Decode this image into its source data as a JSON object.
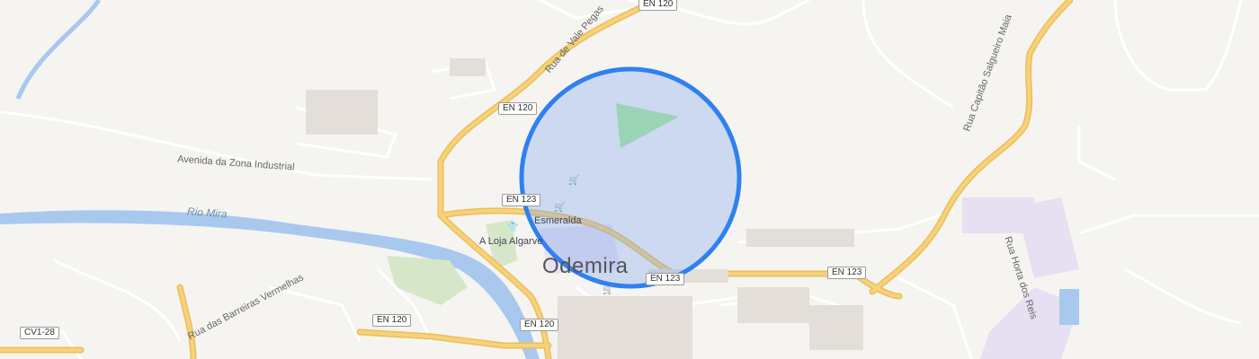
{
  "map": {
    "town": "Odemira",
    "river": "Rio Mira",
    "streets": {
      "avenida_zona_industrial": "Avenida da Zona Industrial",
      "rua_vale_pegas": "Rua de Vale Pegas",
      "rua_barreiras": "Rua das Barreiras Vermelhas",
      "rua_capitao": "Rua Capitão Salgueiro Maia",
      "rua_horta": "Rua Horta dos Reis"
    },
    "road_shields": {
      "en120_a": "EN 120",
      "en120_b": "EN 120",
      "en120_c": "EN 120",
      "en120_d": "EN 120",
      "en123_a": "EN 123",
      "en123_b": "EN 123",
      "en123_c": "EN 123",
      "cv1_28": "CV1-28"
    },
    "pois": {
      "esmeralda": "Esmeralda",
      "loja": "A Loja Algarve"
    },
    "selection_circle_color": "#2f80f0",
    "selection_fill_color": "#7fa6f0",
    "road_major_color": "#f7d27a",
    "water_color": "#a8c8ee"
  }
}
